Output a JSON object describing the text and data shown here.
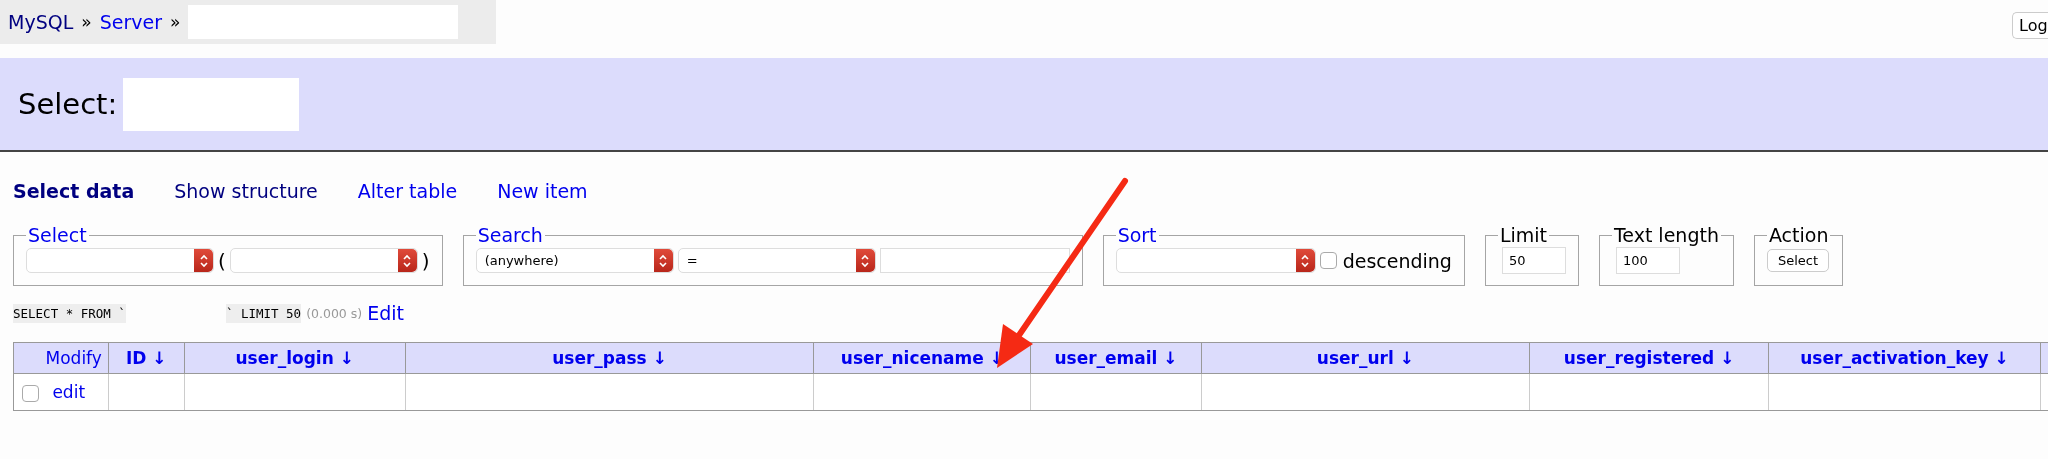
{
  "breadcrumb": [
    {
      "label": "MySQL",
      "kind": "visited"
    },
    {
      "label": "Server",
      "kind": "link"
    }
  ],
  "breadcrumb_separator": "»",
  "logout_button": "Log",
  "title": "Select:",
  "nav": [
    {
      "label": "Select data",
      "selected": true,
      "kind": "visited"
    },
    {
      "label": "Show structure",
      "selected": false,
      "kind": "visited"
    },
    {
      "label": "Alter table",
      "selected": false,
      "kind": "link"
    },
    {
      "label": "New item",
      "selected": false,
      "kind": "link"
    }
  ],
  "fieldsets": [
    {
      "legend": "Select",
      "link": true,
      "kind": "select",
      "open_paren": "(",
      "close_paren": ")"
    },
    {
      "legend": "Search",
      "link": true,
      "kind": "search",
      "column": "(anywhere)",
      "operator": "="
    },
    {
      "legend": "Sort",
      "link": true,
      "kind": "sort",
      "checkbox_label": "descending",
      "checked": false
    },
    {
      "legend": "Limit",
      "link": false,
      "kind": "input",
      "value": "50"
    },
    {
      "legend": "Text length",
      "link": false,
      "kind": "input",
      "value": "100"
    },
    {
      "legend": "Action",
      "link": false,
      "kind": "button",
      "button": "Select"
    }
  ],
  "query": {
    "start": "SELECT * FROM `",
    "end": "` LIMIT 50",
    "time": "(0.000 s)",
    "edit": "Edit"
  },
  "table": {
    "columns": [
      "Modify",
      "ID ↓",
      "user_login ↓",
      "user_pass ↓",
      "user_nicename ↓",
      "user_email ↓",
      "user_url ↓",
      "user_registered ↓",
      "user_activation_key ↓"
    ],
    "rows": [
      {
        "checked": false,
        "action": "edit"
      }
    ]
  }
}
